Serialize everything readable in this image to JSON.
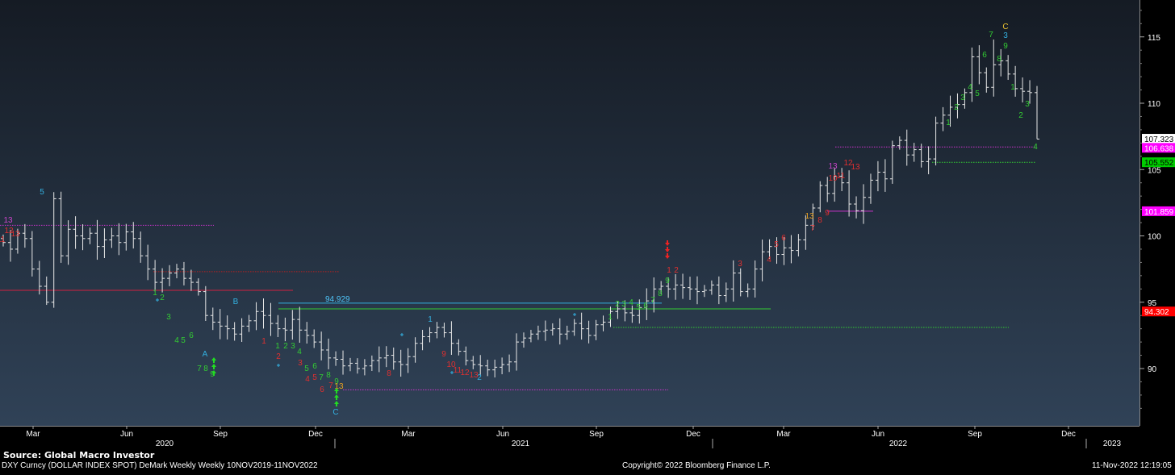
{
  "footer": {
    "source": "Source: Global Macro Investor",
    "ticker": "DXY Curncy (DOLLAR INDEX SPOT) DeMark Weekly  Weekly 10NOV2019-11NOV2022",
    "copyright": "Copyright© 2022 Bloomberg Finance L.P.",
    "timestamp": "11-Nov-2022 12:19:05"
  },
  "chart_data": {
    "type": "ohlc",
    "frequency": "weekly",
    "ylim": [
      86.5,
      118.5
    ],
    "y_ticks": [
      90,
      95,
      100,
      105,
      110,
      115
    ],
    "x_month_ticks": [
      "Mar",
      "Jun",
      "Sep",
      "Dec",
      "Mar",
      "Jun",
      "Sep",
      "Dec",
      "Mar",
      "Jun",
      "Sep",
      "Dec"
    ],
    "x_year_labels": [
      "2020",
      "2021",
      "2022",
      "2023"
    ],
    "price_tags": [
      {
        "value": 107.323,
        "label": "107.323",
        "bg": "#ffffff",
        "fg": "#000000"
      },
      {
        "value": 106.638,
        "label": "106.638",
        "bg": "#ff00ff",
        "fg": "#ffffff"
      },
      {
        "value": 105.552,
        "label": "105.552",
        "bg": "#00cc00",
        "fg": "#000000"
      },
      {
        "value": 101.859,
        "label": "101.859",
        "bg": "#ff00ff",
        "fg": "#ffffff"
      },
      {
        "value": 94.302,
        "label": "94.302",
        "bg": "#ff0000",
        "fg": "#ffffff"
      }
    ],
    "annotation_value": "94.929",
    "levels": [
      {
        "value": 100.8,
        "color": "#cc33cc",
        "style": "dotted"
      },
      {
        "value": 97.3,
        "color": "#b82020",
        "style": "dotted"
      },
      {
        "value": 95.9,
        "color": "#d02040",
        "style": "solid"
      },
      {
        "value": 94.929,
        "color": "#33b0e0",
        "style": "solid"
      },
      {
        "value": 94.5,
        "color": "#33cc33",
        "style": "solid"
      },
      {
        "value": 93.1,
        "color": "#33cc33",
        "style": "dotted"
      },
      {
        "value": 88.4,
        "color": "#cc33cc",
        "style": "dotted"
      },
      {
        "value": 106.7,
        "color": "#cc33cc",
        "style": "dotted"
      },
      {
        "value": 105.55,
        "color": "#33cc33",
        "style": "dotted"
      },
      {
        "value": 101.86,
        "color": "#cc33cc",
        "style": "solid"
      }
    ],
    "demark_labels": [
      {
        "text": "11",
        "color": "#e03030"
      },
      {
        "text": "12",
        "color": "#e03030"
      },
      {
        "text": "13",
        "color": "#e03030"
      },
      {
        "text": "13",
        "color": "#cc44cc"
      },
      {
        "text": "5",
        "color": "#33b0e0"
      },
      {
        "text": "1",
        "color": "#33cc33"
      },
      {
        "text": "2",
        "color": "#33cc33"
      },
      {
        "text": "3",
        "color": "#33cc33"
      },
      {
        "text": "4",
        "color": "#33cc33"
      },
      {
        "text": "5",
        "color": "#33cc33"
      },
      {
        "text": "6",
        "color": "#33cc33"
      },
      {
        "text": "7",
        "color": "#33cc33"
      },
      {
        "text": "8",
        "color": "#33cc33"
      },
      {
        "text": "9",
        "color": "#33cc33"
      },
      {
        "text": "A",
        "color": "#33b0e0"
      },
      {
        "text": "B",
        "color": "#33b0e0"
      },
      {
        "text": "1",
        "color": "#e03030"
      },
      {
        "text": "2",
        "color": "#e03030"
      },
      {
        "text": "3",
        "color": "#e03030"
      },
      {
        "text": "4",
        "color": "#e03030"
      },
      {
        "text": "5",
        "color": "#e03030"
      },
      {
        "text": "6",
        "color": "#e03030"
      },
      {
        "text": "7",
        "color": "#e03030"
      },
      {
        "text": "1",
        "color": "#33cc33"
      },
      {
        "text": "2",
        "color": "#33cc33"
      },
      {
        "text": "3",
        "color": "#33cc33"
      },
      {
        "text": "4",
        "color": "#33cc33"
      },
      {
        "text": "5",
        "color": "#33cc33"
      },
      {
        "text": "6",
        "color": "#33cc33"
      },
      {
        "text": "7",
        "color": "#33cc33"
      },
      {
        "text": "8",
        "color": "#33cc33"
      },
      {
        "text": "9",
        "color": "#33cc33"
      },
      {
        "text": "13",
        "color": "#e8a020"
      },
      {
        "text": "C",
        "color": "#33b0e0"
      },
      {
        "text": "8",
        "color": "#e03030"
      },
      {
        "text": "1",
        "color": "#33b0e0"
      },
      {
        "text": "9",
        "color": "#e03030"
      },
      {
        "text": "10",
        "color": "#e03030"
      },
      {
        "text": "11",
        "color": "#e03030"
      },
      {
        "text": "12",
        "color": "#e03030"
      },
      {
        "text": "13",
        "color": "#e03030"
      },
      {
        "text": "2",
        "color": "#33b0e0"
      },
      {
        "text": "1",
        "color": "#33cc33"
      },
      {
        "text": "2",
        "color": "#33cc33"
      },
      {
        "text": "3",
        "color": "#33cc33"
      },
      {
        "text": "4",
        "color": "#33cc33"
      },
      {
        "text": "5",
        "color": "#33cc33"
      },
      {
        "text": "6",
        "color": "#33cc33"
      },
      {
        "text": "7",
        "color": "#33cc33"
      },
      {
        "text": "8",
        "color": "#33cc33"
      },
      {
        "text": "9",
        "color": "#33cc33"
      },
      {
        "text": "1",
        "color": "#e03030"
      },
      {
        "text": "2",
        "color": "#e03030"
      },
      {
        "text": "3",
        "color": "#e03030"
      },
      {
        "text": "4",
        "color": "#e03030"
      },
      {
        "text": "5",
        "color": "#e03030"
      },
      {
        "text": "6",
        "color": "#e03030"
      },
      {
        "text": "7",
        "color": "#e03030"
      },
      {
        "text": "8",
        "color": "#e03030"
      },
      {
        "text": "9",
        "color": "#e03030"
      },
      {
        "text": "13",
        "color": "#e8a020"
      },
      {
        "text": "13",
        "color": "#cc44cc"
      },
      {
        "text": "10",
        "color": "#e03030"
      },
      {
        "text": "11",
        "color": "#e03030"
      },
      {
        "text": "12",
        "color": "#e03030"
      },
      {
        "text": "13",
        "color": "#e03030"
      },
      {
        "text": "1",
        "color": "#33cc33"
      },
      {
        "text": "2",
        "color": "#33cc33"
      },
      {
        "text": "3",
        "color": "#33cc33"
      },
      {
        "text": "4",
        "color": "#33cc33"
      },
      {
        "text": "5",
        "color": "#33cc33"
      },
      {
        "text": "6",
        "color": "#33cc33"
      },
      {
        "text": "7",
        "color": "#33cc33"
      },
      {
        "text": "8",
        "color": "#33cc33"
      },
      {
        "text": "9",
        "color": "#33cc33"
      },
      {
        "text": "3",
        "color": "#33b0e0"
      },
      {
        "text": "C",
        "color": "#e8c030"
      },
      {
        "text": "1",
        "color": "#33cc33"
      },
      {
        "text": "2",
        "color": "#33cc33"
      },
      {
        "text": "3",
        "color": "#33cc33"
      },
      {
        "text": "4",
        "color": "#33cc33"
      }
    ],
    "weekly_close_path": [
      99.5,
      99.0,
      100.2,
      99.8,
      97.5,
      96.2,
      95.0,
      102.8,
      98.5,
      100.5,
      100.0,
      99.8,
      100.2,
      99.2,
      99.7,
      100.0,
      99.5,
      100.3,
      99.8,
      98.5,
      97.5,
      96.5,
      96.8,
      97.2,
      97.5,
      96.8,
      96.5,
      95.8,
      94.0,
      93.5,
      93.2,
      93.0,
      92.6,
      93.2,
      93.6,
      94.3,
      94.0,
      93.4,
      93.0,
      92.9,
      93.7,
      92.9,
      92.5,
      92.0,
      91.4,
      90.8,
      90.7,
      90.2,
      90.4,
      90.0,
      90.2,
      90.6,
      90.8,
      91.0,
      90.5,
      90.3,
      90.9,
      91.9,
      92.4,
      92.7,
      93.1,
      92.7,
      91.9,
      91.3,
      90.6,
      90.3,
      90.2,
      89.9,
      90.1,
      90.3,
      90.5,
      92.0,
      92.3,
      92.6,
      92.8,
      92.9,
      93.0,
      92.6,
      92.8,
      93.4,
      93.0,
      92.5,
      93.3,
      93.5,
      94.3,
      94.5,
      94.2,
      94.0,
      94.6,
      95.1,
      96.0,
      96.2,
      96.0,
      96.3,
      96.1,
      96.0,
      95.8,
      95.9,
      96.3,
      95.5,
      96.0,
      97.2,
      95.8,
      96.0,
      97.5,
      98.8,
      99.2,
      98.6,
      99.1,
      98.9,
      99.7,
      100.8,
      102.1,
      103.8,
      103.2,
      104.5,
      104.0,
      102.4,
      101.9,
      102.9,
      104.2,
      104.8,
      104.3,
      106.8,
      107.2,
      106.1,
      106.5,
      105.6,
      105.8,
      108.5,
      109.1,
      109.7,
      109.9,
      110.8,
      113.5,
      112.3,
      111.2,
      112.9,
      113.2,
      112.2,
      111.1,
      110.9,
      110.8,
      107.3
    ]
  }
}
